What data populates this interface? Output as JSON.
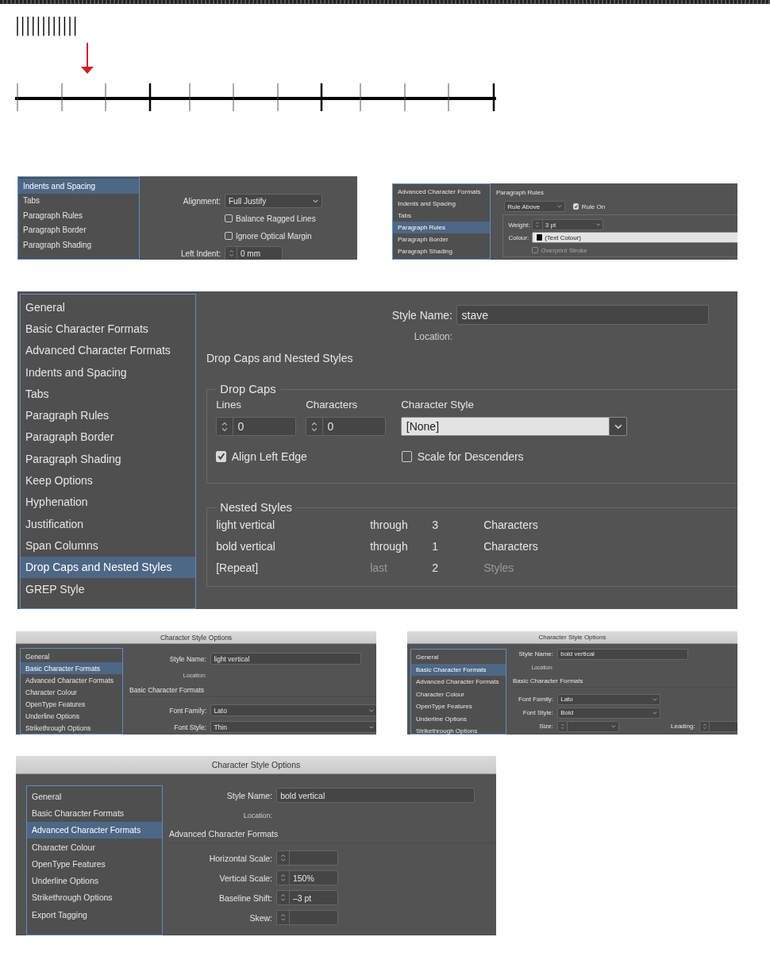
{
  "panels": [
    {
      "sidebar": [
        {
          "label": "Indents and Spacing",
          "selected": true
        },
        {
          "label": "Tabs",
          "selected": false
        },
        {
          "label": "Paragraph Rules",
          "selected": false
        },
        {
          "label": "Paragraph Border",
          "selected": false
        },
        {
          "label": "Paragraph Shading",
          "selected": false
        }
      ],
      "blocks": [
        {
          "kind": "row",
          "label": "Alignment:",
          "controls": [
            {
              "kind": "select",
              "value": "Full Justify"
            }
          ]
        },
        {
          "kind": "row",
          "controls": [
            {
              "kind": "checkbox",
              "label": "Balance Ragged Lines",
              "checked": false,
              "disabled": false
            }
          ]
        },
        {
          "kind": "row",
          "controls": [
            {
              "kind": "checkbox",
              "label": "Ignore Optical Margin",
              "checked": false,
              "disabled": false
            }
          ]
        },
        {
          "kind": "row",
          "label": "Left Indent:",
          "controls": [
            {
              "kind": "spinner",
              "value": "0 mm"
            }
          ]
        }
      ]
    },
    {
      "sidebar": [
        {
          "label": "Advanced Character Formats",
          "selected": false
        },
        {
          "label": "Indents and Spacing",
          "selected": false
        },
        {
          "label": "Tabs",
          "selected": false
        },
        {
          "label": "Paragraph Rules",
          "selected": true
        },
        {
          "label": "Paragraph Border",
          "selected": false
        },
        {
          "label": "Paragraph Shading",
          "selected": false
        }
      ],
      "blocks": [
        {
          "kind": "heading",
          "text": "Paragraph Rules"
        },
        {
          "kind": "line",
          "controls": [
            {
              "kind": "select",
              "value": "Rule Above"
            },
            {
              "kind": "checkbox",
              "label": "Rule On",
              "checked": true,
              "disabled": false
            }
          ]
        },
        {
          "kind": "group",
          "blocks": [
            {
              "kind": "row",
              "label": "Weight:",
              "controls": [
                {
                  "kind": "spinselect",
                  "value": "3 pt"
                }
              ]
            },
            {
              "kind": "row",
              "label": "Colour:",
              "controls": [
                {
                  "kind": "colorselect",
                  "value": "(Text Colour)"
                }
              ]
            },
            {
              "kind": "row",
              "controls": [
                {
                  "kind": "checkbox",
                  "label": "Overprint Stroke",
                  "checked": false,
                  "disabled": true
                }
              ]
            }
          ]
        }
      ]
    },
    {
      "sidebar": [
        {
          "label": "General",
          "selected": false
        },
        {
          "label": "Basic Character Formats",
          "selected": false
        },
        {
          "label": "Advanced Character Formats",
          "selected": false
        },
        {
          "label": "Indents and Spacing",
          "selected": false
        },
        {
          "label": "Tabs",
          "selected": false
        },
        {
          "label": "Paragraph Rules",
          "selected": false
        },
        {
          "label": "Paragraph Border",
          "selected": false
        },
        {
          "label": "Paragraph Shading",
          "selected": false
        },
        {
          "label": "Keep Options",
          "selected": false
        },
        {
          "label": "Hyphenation",
          "selected": false
        },
        {
          "label": "Justification",
          "selected": false
        },
        {
          "label": "Span Columns",
          "selected": false
        },
        {
          "label": "Drop Caps and Nested Styles",
          "selected": true
        },
        {
          "label": "GREP Style",
          "selected": false
        }
      ],
      "blocks": [
        {
          "kind": "row",
          "label": "Style Name:",
          "controls": [
            {
              "kind": "field",
              "value": "stave"
            }
          ]
        },
        {
          "kind": "meta",
          "label": "Location:"
        },
        {
          "kind": "heading",
          "text": "Drop Caps and Nested Styles"
        },
        {
          "kind": "group",
          "title": "Drop Caps",
          "blocks": [
            {
              "kind": "columns",
              "columns": [
                {
                  "label": "Lines",
                  "control": {
                    "kind": "spinner",
                    "value": "0"
                  }
                },
                {
                  "label": "Characters",
                  "control": {
                    "kind": "spinner",
                    "value": "0"
                  }
                },
                {
                  "label": "Character Style",
                  "control": {
                    "kind": "select",
                    "value": "[None]"
                  }
                }
              ]
            },
            {
              "kind": "line",
              "controls": [
                {
                  "kind": "checkbox",
                  "label": "Align Left Edge",
                  "checked": true,
                  "disabled": false
                },
                {
                  "kind": "checkbox",
                  "label": "Scale for Descenders",
                  "checked": false,
                  "disabled": false
                }
              ]
            }
          ]
        },
        {
          "kind": "group",
          "title": "Nested Styles",
          "blocks": [
            {
              "kind": "table",
              "rows": [
                {
                  "cells": [
                    {
                      "text": "light vertical",
                      "disabled": false
                    },
                    {
                      "text": "through",
                      "disabled": false
                    },
                    {
                      "text": "3",
                      "disabled": false
                    },
                    {
                      "text": "Characters",
                      "disabled": false
                    }
                  ]
                },
                {
                  "cells": [
                    {
                      "text": "bold vertical",
                      "disabled": false
                    },
                    {
                      "text": "through",
                      "disabled": false
                    },
                    {
                      "text": "1",
                      "disabled": false
                    },
                    {
                      "text": "Characters",
                      "disabled": false
                    }
                  ]
                },
                {
                  "cells": [
                    {
                      "text": "[Repeat]",
                      "disabled": false
                    },
                    {
                      "text": "last",
                      "disabled": true
                    },
                    {
                      "text": "2",
                      "disabled": false
                    },
                    {
                      "text": "Styles",
                      "disabled": true
                    }
                  ]
                }
              ]
            }
          ]
        }
      ]
    },
    {
      "title": "Character Style Options",
      "sidebar": [
        {
          "label": "General",
          "selected": false
        },
        {
          "label": "Basic Character Formats",
          "selected": true
        },
        {
          "label": "Advanced Character Formats",
          "selected": false
        },
        {
          "label": "Character Colour",
          "selected": false
        },
        {
          "label": "OpenType Features",
          "selected": false
        },
        {
          "label": "Underline Options",
          "selected": false
        },
        {
          "label": "Strikethrough Options",
          "selected": false
        }
      ],
      "blocks": [
        {
          "kind": "row",
          "label": "Style Name:",
          "controls": [
            {
              "kind": "field",
              "value": "light vertical"
            }
          ]
        },
        {
          "kind": "meta",
          "label": "Location:"
        },
        {
          "kind": "heading",
          "text": "Basic Character Formats"
        },
        {
          "kind": "row",
          "label": "Font Family:",
          "controls": [
            {
              "kind": "select",
              "value": "Lato"
            }
          ]
        },
        {
          "kind": "row",
          "label": "Font Style:",
          "controls": [
            {
              "kind": "select",
              "value": "Thin"
            }
          ]
        }
      ]
    },
    {
      "title": "Character Style Options",
      "sidebar": [
        {
          "label": "General",
          "selected": false
        },
        {
          "label": "Basic Character Formats",
          "selected": true
        },
        {
          "label": "Advanced Character Formats",
          "selected": false
        },
        {
          "label": "Character Colour",
          "selected": false
        },
        {
          "label": "OpenType Features",
          "selected": false
        },
        {
          "label": "Underline Options",
          "selected": false
        },
        {
          "label": "Strikethrough Options",
          "selected": false
        }
      ],
      "blocks": [
        {
          "kind": "row",
          "label": "Style Name:",
          "controls": [
            {
              "kind": "field",
              "value": "bold vertical"
            }
          ]
        },
        {
          "kind": "meta",
          "label": "Location:"
        },
        {
          "kind": "heading",
          "text": "Basic Character Formats"
        },
        {
          "kind": "row",
          "label": "Font Family:",
          "controls": [
            {
              "kind": "select",
              "value": "Lato"
            }
          ]
        },
        {
          "kind": "row",
          "label": "Font Style:",
          "controls": [
            {
              "kind": "select",
              "value": "Bold"
            }
          ]
        },
        {
          "kind": "row",
          "label": "Size:",
          "controls": [
            {
              "kind": "spinselect"
            },
            {
              "kind": "label",
              "text": "Leading:"
            },
            {
              "kind": "spinselect"
            }
          ]
        }
      ]
    },
    {
      "title": "Character Style Options",
      "sidebar": [
        {
          "label": "General",
          "selected": false
        },
        {
          "label": "Basic Character Formats",
          "selected": false
        },
        {
          "label": "Advanced Character Formats",
          "selected": true
        },
        {
          "label": "Character Colour",
          "selected": false
        },
        {
          "label": "OpenType Features",
          "selected": false
        },
        {
          "label": "Underline Options",
          "selected": false
        },
        {
          "label": "Strikethrough Options",
          "selected": false
        },
        {
          "label": "Export Tagging",
          "selected": false
        }
      ],
      "blocks": [
        {
          "kind": "row",
          "label": "Style Name:",
          "controls": [
            {
              "kind": "field",
              "value": "bold vertical"
            }
          ]
        },
        {
          "kind": "meta",
          "label": "Location:"
        },
        {
          "kind": "heading",
          "text": "Advanced Character Formats"
        },
        {
          "kind": "row",
          "label": "Horizontal Scale:",
          "controls": [
            {
              "kind": "spinner"
            }
          ]
        },
        {
          "kind": "row",
          "label": "Vertical Scale:",
          "controls": [
            {
              "kind": "spinner",
              "value": "150%"
            }
          ]
        },
        {
          "kind": "row",
          "label": "Baseline Shift:",
          "controls": [
            {
              "kind": "spinner",
              "value": "–3 pt"
            }
          ]
        },
        {
          "kind": "row",
          "label": "Skew:",
          "controls": [
            {
              "kind": "spinner"
            }
          ]
        }
      ]
    }
  ]
}
